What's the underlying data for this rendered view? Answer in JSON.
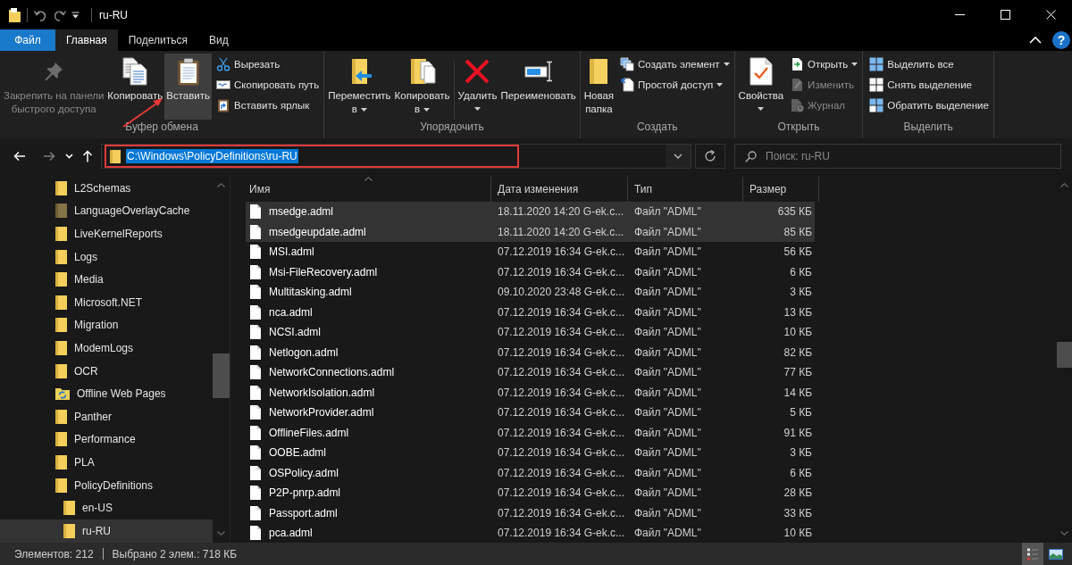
{
  "window": {
    "title": "ru-RU",
    "help_symbol": "?"
  },
  "ribbon": {
    "tabs": [
      {
        "label": "Файл",
        "kind": "file",
        "selected": false
      },
      {
        "label": "Главная",
        "kind": "tab",
        "selected": true
      },
      {
        "label": "Поделиться",
        "kind": "tab",
        "selected": false
      },
      {
        "label": "Вид",
        "kind": "tab",
        "selected": false
      }
    ],
    "groups": [
      {
        "label": "Буфер обмена",
        "commands": [
          {
            "kind": "pin",
            "label": "Закрепить на панели\nбыстрого доступа",
            "disabled": true,
            "hovered": false,
            "has_menu": false
          },
          {
            "kind": "copy",
            "label": "Копировать",
            "disabled": false,
            "hovered": false,
            "has_menu": false
          },
          {
            "kind": "paste",
            "label": "Вставить",
            "disabled": false,
            "hovered": true,
            "has_menu": false
          },
          {
            "kind": "cut",
            "label": "Вырезать",
            "disabled": false,
            "hovered": false,
            "has_menu": false
          },
          {
            "kind": "copypath",
            "label": "Скопировать путь",
            "disabled": false,
            "hovered": false,
            "has_menu": false
          },
          {
            "kind": "shortcut",
            "label": "Вставить ярлык",
            "disabled": false,
            "hovered": false,
            "has_menu": false
          }
        ]
      },
      {
        "label": "Упорядочить",
        "commands": [
          {
            "kind": "move",
            "label": "Переместить\nв",
            "disabled": false,
            "hovered": false,
            "has_menu": true
          },
          {
            "kind": "copyto",
            "label": "Копировать\nв",
            "disabled": false,
            "hovered": false,
            "has_menu": true
          },
          {
            "kind": "delete",
            "label": "Удалить",
            "disabled": false,
            "hovered": false,
            "has_menu": true
          },
          {
            "kind": "rename",
            "label": "Переименовать",
            "disabled": false,
            "hovered": false,
            "has_menu": false
          }
        ]
      },
      {
        "label": "Создать",
        "commands": [
          {
            "kind": "newfolder",
            "label": "Новая\nпапка",
            "disabled": false,
            "hovered": false,
            "has_menu": false
          },
          {
            "kind": "newitem",
            "label": "Создать элемент",
            "disabled": false,
            "hovered": false,
            "has_menu": true
          },
          {
            "kind": "easyaccess",
            "label": "Простой доступ",
            "disabled": false,
            "hovered": false,
            "has_menu": true
          }
        ]
      },
      {
        "label": "Открыть",
        "commands": [
          {
            "kind": "properties",
            "label": "Свойства",
            "disabled": false,
            "hovered": false,
            "has_menu": true
          },
          {
            "kind": "open",
            "label": "Открыть",
            "disabled": false,
            "hovered": false,
            "has_menu": true
          },
          {
            "kind": "edit",
            "label": "Изменить",
            "disabled": true,
            "hovered": false,
            "has_menu": false
          },
          {
            "kind": "history",
            "label": "Журнал",
            "disabled": true,
            "hovered": false,
            "has_menu": false
          }
        ]
      },
      {
        "label": "Выделить",
        "commands": [
          {
            "kind": "selectall",
            "label": "Выделить все",
            "disabled": false,
            "hovered": false,
            "has_menu": false
          },
          {
            "kind": "selectnone",
            "label": "Снять выделение",
            "disabled": false,
            "hovered": false,
            "has_menu": false
          },
          {
            "kind": "invert",
            "label": "Обратить выделение",
            "disabled": false,
            "hovered": false,
            "has_menu": false
          }
        ]
      }
    ]
  },
  "nav_buttons": [
    {
      "kind": "back",
      "disabled": false
    },
    {
      "kind": "forward",
      "disabled": true
    },
    {
      "kind": "recent",
      "disabled": false
    },
    {
      "kind": "up",
      "disabled": false
    }
  ],
  "address_bar": {
    "path": "C:\\Windows\\PolicyDefinitions\\ru-RU",
    "text_selected": true
  },
  "search": {
    "placeholder": "Поиск: ru-RU"
  },
  "sidebar": {
    "items": [
      {
        "label": "L2Schemas",
        "kind": "folder",
        "selected": false
      },
      {
        "label": "LanguageOverlayCache",
        "kind": "hidden",
        "selected": false
      },
      {
        "label": "LiveKernelReports",
        "kind": "folder",
        "selected": false
      },
      {
        "label": "Logs",
        "kind": "folder",
        "selected": false
      },
      {
        "label": "Media",
        "kind": "folder",
        "selected": false
      },
      {
        "label": "Microsoft.NET",
        "kind": "folder",
        "selected": false
      },
      {
        "label": "Migration",
        "kind": "folder",
        "selected": false
      },
      {
        "label": "ModemLogs",
        "kind": "folder",
        "selected": false
      },
      {
        "label": "OCR",
        "kind": "folder",
        "selected": false
      },
      {
        "label": "Offline Web Pages",
        "kind": "offline",
        "selected": false
      },
      {
        "label": "Panther",
        "kind": "folder",
        "selected": false
      },
      {
        "label": "Performance",
        "kind": "folder",
        "selected": false
      },
      {
        "label": "PLA",
        "kind": "folder",
        "selected": false
      },
      {
        "label": "PolicyDefinitions",
        "kind": "folder",
        "selected": false,
        "children": [
          {
            "label": "en-US",
            "kind": "folder",
            "selected": false
          },
          {
            "label": "ru-RU",
            "kind": "folder",
            "selected": true
          }
        ]
      }
    ]
  },
  "file_list": {
    "columns": [
      {
        "label": "Имя",
        "sorted": true
      },
      {
        "label": "Дата изменения",
        "sorted": false
      },
      {
        "label": "Тип",
        "sorted": false
      },
      {
        "label": "Размер",
        "sorted": false
      }
    ],
    "rows": [
      {
        "name": "msedge.adml",
        "modified": "18.11.2020 14:20 G-ek.c...",
        "type": "Файл \"ADML\"",
        "size": "635 КБ",
        "selected": true
      },
      {
        "name": "msedgeupdate.adml",
        "modified": "18.11.2020 14:20 G-ek.c...",
        "type": "Файл \"ADML\"",
        "size": "85 КБ",
        "selected": true
      },
      {
        "name": "MSI.adml",
        "modified": "07.12.2019 16:34 G-ek.c...",
        "type": "Файл \"ADML\"",
        "size": "56 КБ",
        "selected": false
      },
      {
        "name": "Msi-FileRecovery.adml",
        "modified": "07.12.2019 16:34 G-ek.c...",
        "type": "Файл \"ADML\"",
        "size": "6 КБ",
        "selected": false
      },
      {
        "name": "Multitasking.adml",
        "modified": "09.10.2020 23:48 G-ek.c...",
        "type": "Файл \"ADML\"",
        "size": "3 КБ",
        "selected": false
      },
      {
        "name": "nca.adml",
        "modified": "07.12.2019 16:34 G-ek.c...",
        "type": "Файл \"ADML\"",
        "size": "13 КБ",
        "selected": false
      },
      {
        "name": "NCSI.adml",
        "modified": "07.12.2019 16:34 G-ek.c...",
        "type": "Файл \"ADML\"",
        "size": "10 КБ",
        "selected": false
      },
      {
        "name": "Netlogon.adml",
        "modified": "07.12.2019 16:34 G-ek.c...",
        "type": "Файл \"ADML\"",
        "size": "82 КБ",
        "selected": false
      },
      {
        "name": "NetworkConnections.adml",
        "modified": "07.12.2019 16:34 G-ek.c...",
        "type": "Файл \"ADML\"",
        "size": "77 КБ",
        "selected": false
      },
      {
        "name": "NetworkIsolation.adml",
        "modified": "07.12.2019 16:34 G-ek.c...",
        "type": "Файл \"ADML\"",
        "size": "14 КБ",
        "selected": false
      },
      {
        "name": "NetworkProvider.adml",
        "modified": "07.12.2019 16:34 G-ek.c...",
        "type": "Файл \"ADML\"",
        "size": "5 КБ",
        "selected": false
      },
      {
        "name": "OfflineFiles.adml",
        "modified": "07.12.2019 16:34 G-ek.c...",
        "type": "Файл \"ADML\"",
        "size": "91 КБ",
        "selected": false
      },
      {
        "name": "OOBE.adml",
        "modified": "07.12.2019 16:34 G-ek.c...",
        "type": "Файл \"ADML\"",
        "size": "3 КБ",
        "selected": false
      },
      {
        "name": "OSPolicy.adml",
        "modified": "07.12.2019 16:34 G-ek.c...",
        "type": "Файл \"ADML\"",
        "size": "6 КБ",
        "selected": false
      },
      {
        "name": "P2P-pnrp.adml",
        "modified": "07.12.2019 16:34 G-ek.c...",
        "type": "Файл \"ADML\"",
        "size": "28 КБ",
        "selected": false
      },
      {
        "name": "Passport.adml",
        "modified": "07.12.2019 16:34 G-ek.c...",
        "type": "Файл \"ADML\"",
        "size": "33 КБ",
        "selected": false
      },
      {
        "name": "pca.adml",
        "modified": "07.12.2019 16:34 G-ek.c...",
        "type": "Файл \"ADML\"",
        "size": "10 КБ",
        "selected": false
      }
    ]
  },
  "status_bar": {
    "item_count": "Элементов: 212",
    "selection": "Выбрано 2 элем.: 718 КБ",
    "view_buttons": [
      {
        "kind": "details",
        "selected": true
      },
      {
        "kind": "large_icons",
        "selected": false
      }
    ]
  }
}
